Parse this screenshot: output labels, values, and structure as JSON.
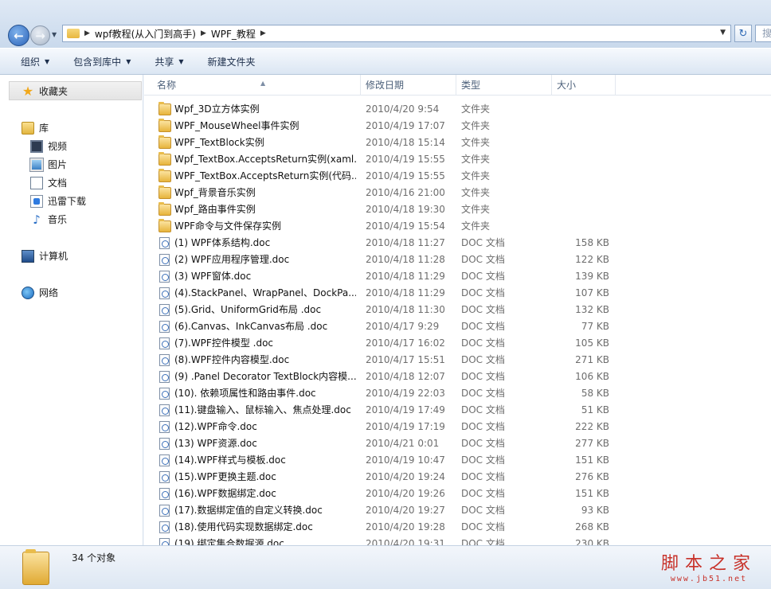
{
  "address": {
    "crumbs": [
      "wpf教程(从入门到高手)",
      "WPF_教程"
    ],
    "search_placeholder": "搜"
  },
  "toolbar": {
    "organize": "组织",
    "include_library": "包含到库中",
    "share": "共享",
    "new_folder": "新建文件夹"
  },
  "nav": {
    "favorites": "收藏夹",
    "libraries": "库",
    "library_items": [
      "视频",
      "图片",
      "文档",
      "迅雷下载",
      "音乐"
    ],
    "computer": "计算机",
    "network": "网络"
  },
  "columns": {
    "name": "名称",
    "date": "修改日期",
    "type": "类型",
    "size": "大小"
  },
  "files": [
    {
      "icon": "folder",
      "name": "Wpf_3D立方体实例",
      "date": "2010/4/20 9:54",
      "type": "文件夹",
      "size": ""
    },
    {
      "icon": "folder",
      "name": "WPF_MouseWheel事件实例",
      "date": "2010/4/19 17:07",
      "type": "文件夹",
      "size": ""
    },
    {
      "icon": "folder",
      "name": "WPF_TextBlock实例",
      "date": "2010/4/18 15:14",
      "type": "文件夹",
      "size": ""
    },
    {
      "icon": "folder",
      "name": "Wpf_TextBox.AcceptsReturn实例(xaml...",
      "date": "2010/4/19 15:55",
      "type": "文件夹",
      "size": ""
    },
    {
      "icon": "folder",
      "name": "WPF_TextBox.AcceptsReturn实例(代码...",
      "date": "2010/4/19 15:55",
      "type": "文件夹",
      "size": ""
    },
    {
      "icon": "folder",
      "name": "Wpf_背景音乐实例",
      "date": "2010/4/16 21:00",
      "type": "文件夹",
      "size": ""
    },
    {
      "icon": "folder",
      "name": "Wpf_路由事件实例",
      "date": "2010/4/18 19:30",
      "type": "文件夹",
      "size": ""
    },
    {
      "icon": "folder",
      "name": "WPF命令与文件保存实例",
      "date": "2010/4/19 15:54",
      "type": "文件夹",
      "size": ""
    },
    {
      "icon": "doc",
      "name": "(1) WPF体系结构.doc",
      "date": "2010/4/18 11:27",
      "type": "DOC 文档",
      "size": "158 KB"
    },
    {
      "icon": "doc",
      "name": "(2) WPF应用程序管理.doc",
      "date": "2010/4/18 11:28",
      "type": "DOC 文档",
      "size": "122 KB"
    },
    {
      "icon": "doc",
      "name": "(3) WPF窗体.doc",
      "date": "2010/4/18 11:29",
      "type": "DOC 文档",
      "size": "139 KB"
    },
    {
      "icon": "doc",
      "name": "(4).StackPanel、WrapPanel、DockPa...",
      "date": "2010/4/18 11:29",
      "type": "DOC 文档",
      "size": "107 KB"
    },
    {
      "icon": "doc",
      "name": "(5).Grid、UniformGrid布局 .doc",
      "date": "2010/4/18 11:30",
      "type": "DOC 文档",
      "size": "132 KB"
    },
    {
      "icon": "doc",
      "name": "(6).Canvas、InkCanvas布局 .doc",
      "date": "2010/4/17 9:29",
      "type": "DOC 文档",
      "size": "77 KB"
    },
    {
      "icon": "doc",
      "name": "(7).WPF控件模型 .doc",
      "date": "2010/4/17 16:02",
      "type": "DOC 文档",
      "size": "105 KB"
    },
    {
      "icon": "doc",
      "name": "(8).WPF控件内容模型.doc",
      "date": "2010/4/17 15:51",
      "type": "DOC 文档",
      "size": "271 KB"
    },
    {
      "icon": "doc",
      "name": "(9) .Panel  Decorator TextBlock内容模...",
      "date": "2010/4/18 12:07",
      "type": "DOC 文档",
      "size": "106 KB"
    },
    {
      "icon": "doc",
      "name": "(10). 依赖项属性和路由事件.doc",
      "date": "2010/4/19 22:03",
      "type": "DOC 文档",
      "size": "58 KB"
    },
    {
      "icon": "doc",
      "name": "(11).键盘输入、鼠标输入、焦点处理.doc",
      "date": "2010/4/19 17:49",
      "type": "DOC 文档",
      "size": "51 KB"
    },
    {
      "icon": "doc",
      "name": "(12).WPF命令.doc",
      "date": "2010/4/19 17:19",
      "type": "DOC 文档",
      "size": "222 KB"
    },
    {
      "icon": "doc",
      "name": "(13) WPF资源.doc",
      "date": "2010/4/21 0:01",
      "type": "DOC 文档",
      "size": "277 KB"
    },
    {
      "icon": "doc",
      "name": "(14).WPF样式与模板.doc",
      "date": "2010/4/19 10:47",
      "type": "DOC 文档",
      "size": "151 KB"
    },
    {
      "icon": "doc",
      "name": "(15).WPF更换主题.doc",
      "date": "2010/4/20 19:24",
      "type": "DOC 文档",
      "size": "276 KB"
    },
    {
      "icon": "doc",
      "name": "(16).WPF数据绑定.doc",
      "date": "2010/4/20 19:26",
      "type": "DOC 文档",
      "size": "151 KB"
    },
    {
      "icon": "doc",
      "name": "(17).数据绑定值的自定义转换.doc",
      "date": "2010/4/20 19:27",
      "type": "DOC 文档",
      "size": "93 KB"
    },
    {
      "icon": "doc",
      "name": "(18).使用代码实现数据绑定.doc",
      "date": "2010/4/20 19:28",
      "type": "DOC 文档",
      "size": "268 KB"
    },
    {
      "icon": "doc",
      "name": "(19).绑定集合数据源.doc",
      "date": "2010/4/20 19:31",
      "type": "DOC 文档",
      "size": "230 KB"
    }
  ],
  "details": {
    "count": "34 个对象"
  },
  "watermark": {
    "main": "脚本之家",
    "sub": "www.jb51.net"
  }
}
